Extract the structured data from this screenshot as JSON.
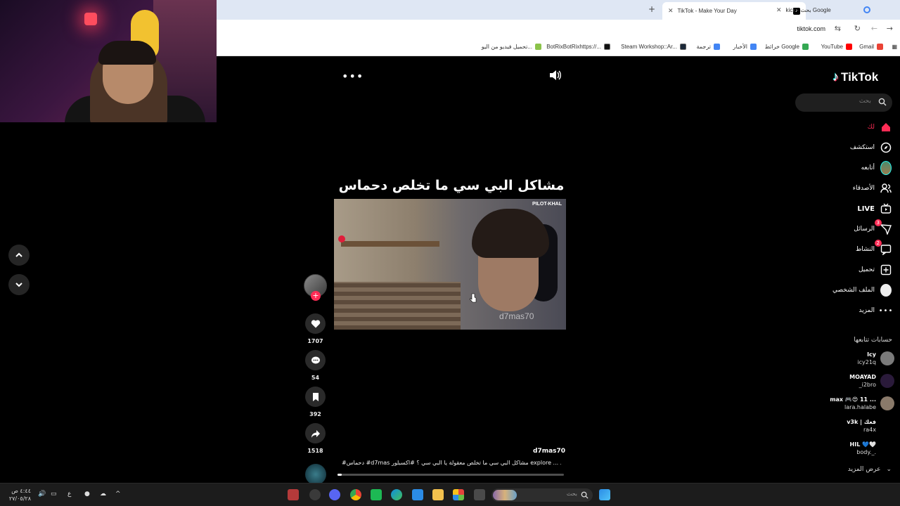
{
  "browser": {
    "tabs": [
      {
        "title": "kick - بحث Google",
        "active": false
      },
      {
        "title": "TikTok - Make Your Day",
        "active": true
      }
    ],
    "url": "tiktok.com",
    "bookmarks": [
      {
        "label": "Gmail",
        "color": "#ea4335"
      },
      {
        "label": "YouTube",
        "color": "#ff0000"
      },
      {
        "label": "خرائط Google",
        "color": "#34a853"
      },
      {
        "label": "الأخبار",
        "color": "#4285f4"
      },
      {
        "label": "ترجمة",
        "color": "#4285f4"
      },
      {
        "label": "Steam Workshop::Ar...",
        "color": "#1b2838"
      },
      {
        "label": "BotRixBotRixhttps://...",
        "color": "#111111"
      },
      {
        "label": "تحميل فيديو من اليو...",
        "color": "#8bc34a"
      }
    ]
  },
  "tiktok": {
    "logo": "TikTok",
    "search_placeholder": "بحث",
    "nav": [
      {
        "label": "لك",
        "icon": "home-icon",
        "active": true
      },
      {
        "label": "استكشف",
        "icon": "compass-icon",
        "active": false
      },
      {
        "label": "أتابعه",
        "icon": "following-avatar-icon",
        "active": false
      },
      {
        "label": "الأصدقاء",
        "icon": "friends-icon",
        "active": false
      },
      {
        "label": "LIVE",
        "icon": "live-icon",
        "active": false
      },
      {
        "label": "الرسائل",
        "icon": "messages-icon",
        "active": false,
        "badge": "3"
      },
      {
        "label": "النشاط",
        "icon": "activity-icon",
        "active": false,
        "badge": "2"
      },
      {
        "label": "تحميل",
        "icon": "upload-icon",
        "active": false
      },
      {
        "label": "الملف الشخصي",
        "icon": "profile-icon",
        "active": false
      },
      {
        "label": "المزيد",
        "icon": "more-icon",
        "active": false
      }
    ],
    "following_title": "حسابات تتابعها",
    "following": [
      {
        "name": "Icy",
        "handle": "icy21q"
      },
      {
        "name": "MOAYAD",
        "handle": "_i2bro"
      },
      {
        "name": "max 🎮😍 11 ...",
        "handle": "lara.halabe"
      },
      {
        "name": "v3k | فعك",
        "handle": "ra4x"
      },
      {
        "name": "HIL 💙🤍",
        "handle": "body._."
      }
    ],
    "see_more": "عرض المزيد",
    "video": {
      "caption_title": "مشاكل البي سي ما تخلص دحماس",
      "watermark": "d7mas70",
      "corner_tag": "PILOT-KHAL",
      "author": "d7mas70",
      "description": "#دحماس #d7mas مشاكل البي سي ما تخلص معقولة يا البي سي ؟ #اكسبلور explore ... المزيد",
      "progress": 0.02,
      "likes": "1707",
      "comments": "54",
      "saves": "392",
      "shares": "1518"
    }
  },
  "taskbar": {
    "search_placeholder": "بحث",
    "time": "٤:٤٤ ص",
    "date": "٢٧/٠٥/٢٨",
    "lang": "ع"
  }
}
